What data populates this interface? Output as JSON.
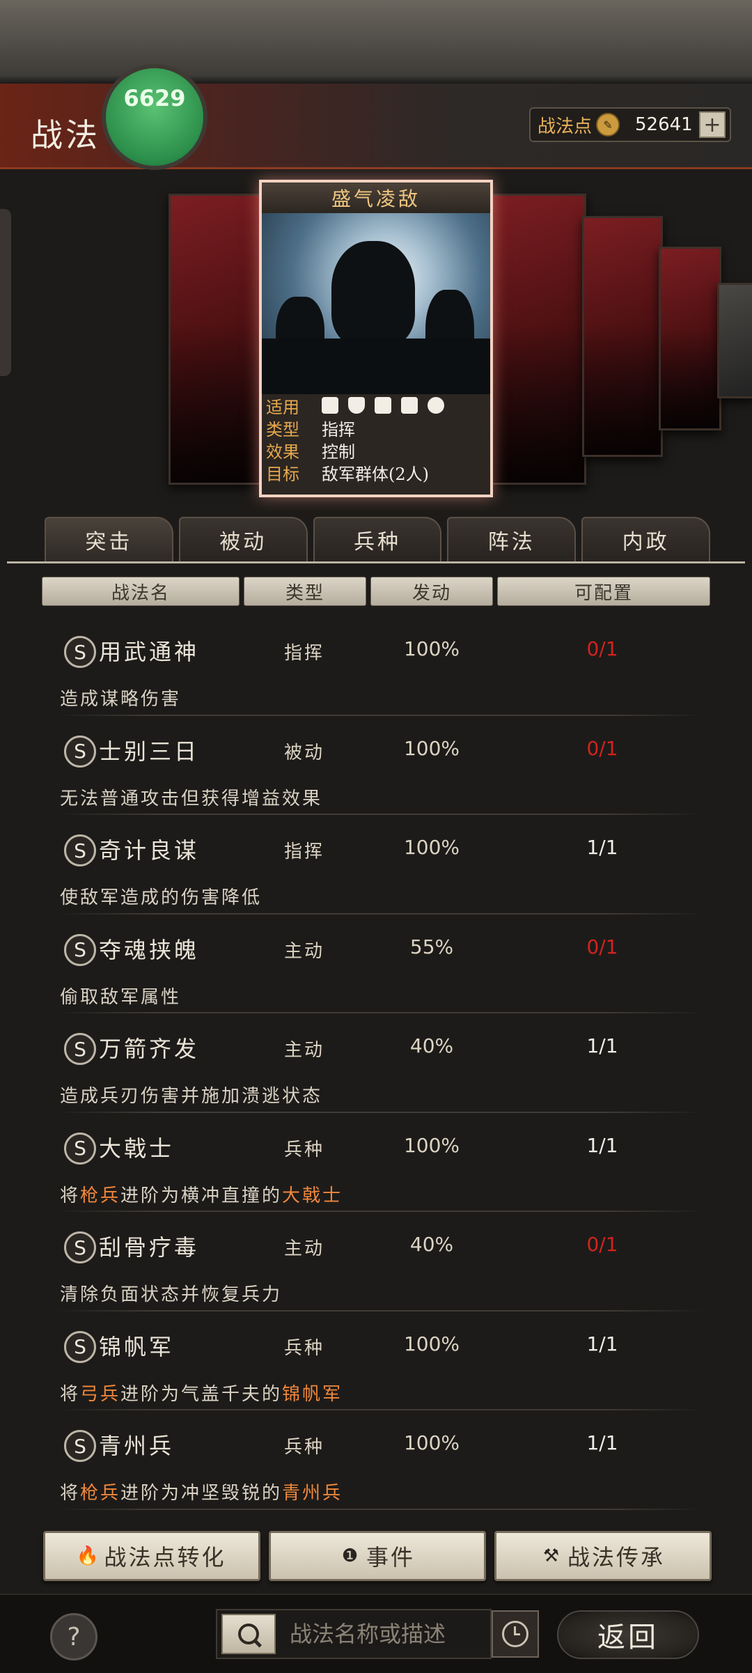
{
  "header": {
    "title": "战法",
    "badge_text": "6629"
  },
  "points": {
    "label": "战法点",
    "value": "52641",
    "plus": "+"
  },
  "featured": {
    "name": "盛气凌敌",
    "attributes": [
      {
        "key": "适用",
        "value": ""
      },
      {
        "key": "类型",
        "value": "指挥"
      },
      {
        "key": "效果",
        "value": "控制"
      },
      {
        "key": "目标",
        "value": "敌军群体(2人)"
      }
    ]
  },
  "tabs": [
    "突击",
    "被动",
    "兵种",
    "阵法",
    "内政"
  ],
  "columns": {
    "name": "战法名",
    "type": "类型",
    "rate": "发动",
    "conf": "可配置"
  },
  "rows": [
    {
      "badge": "S",
      "name": "用武通神",
      "type": "指挥",
      "rate": "100%",
      "conf": "0/1",
      "desc": "造成谋略伤害"
    },
    {
      "badge": "S",
      "name": "士别三日",
      "type": "被动",
      "rate": "100%",
      "conf": "0/1",
      "desc": "无法普通攻击但获得增益效果"
    },
    {
      "badge": "S",
      "name": "奇计良谋",
      "type": "指挥",
      "rate": "100%",
      "conf": "1/1",
      "desc": "使敌军造成的伤害降低"
    },
    {
      "badge": "S",
      "name": "夺魂挟魄",
      "type": "主动",
      "rate": "55%",
      "conf": "0/1",
      "desc": "偷取敌军属性"
    },
    {
      "badge": "S",
      "name": "万箭齐发",
      "type": "主动",
      "rate": "40%",
      "conf": "1/1",
      "desc": "造成兵刃伤害并施加溃逃状态"
    },
    {
      "badge": "S",
      "name": "大戟士",
      "type": "兵种",
      "rate": "100%",
      "conf": "1/1",
      "desc_a": "将",
      "desc_h1": "枪兵",
      "desc_b": "进阶为横冲直撞的",
      "desc_h2": "大戟士"
    },
    {
      "badge": "S",
      "name": "刮骨疗毒",
      "type": "主动",
      "rate": "40%",
      "conf": "0/1",
      "desc": "清除负面状态并恢复兵力"
    },
    {
      "badge": "S",
      "name": "锦帆军",
      "type": "兵种",
      "rate": "100%",
      "conf": "1/1",
      "desc_a": "将",
      "desc_h1": "弓兵",
      "desc_b": "进阶为气盖千夫的",
      "desc_h2": "锦帆军"
    },
    {
      "badge": "S",
      "name": "青州兵",
      "type": "兵种",
      "rate": "100%",
      "conf": "1/1",
      "desc_a": "将",
      "desc_h1": "枪兵",
      "desc_b": "进阶为冲坚毁锐的",
      "desc_h2": "青州兵"
    }
  ],
  "buttons": {
    "convert": "战法点转化",
    "events": "事件",
    "inherit": "战法传承"
  },
  "footer": {
    "help": "?",
    "search_placeholder": "战法名称或描述",
    "back": "返回"
  },
  "colors": {
    "accent_red": "#d2231e",
    "highlight_orange": "#f0873c",
    "points_gold": "#e9b25a"
  }
}
